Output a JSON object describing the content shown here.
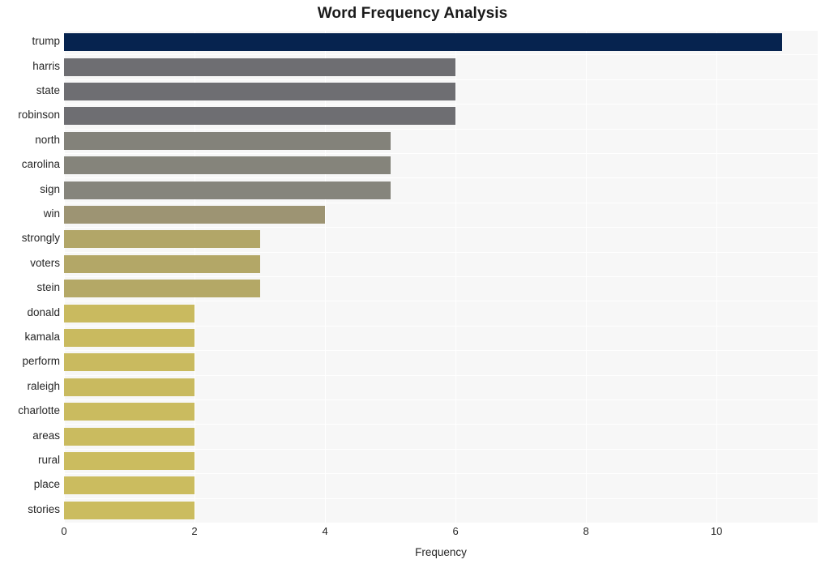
{
  "chart_data": {
    "type": "bar",
    "orientation": "horizontal",
    "title": "Word Frequency Analysis",
    "xlabel": "Frequency",
    "ylabel": "",
    "xlim": [
      0,
      11.55
    ],
    "xticks": [
      0,
      2,
      4,
      6,
      8,
      10
    ],
    "xtick_labels": [
      "0",
      "2",
      "4",
      "6",
      "8",
      "10"
    ],
    "grid": true,
    "grid_color": "#ffffff",
    "legend": "none",
    "plot_background": "#f7f7f7",
    "figure_background": "#ffffff",
    "categories": [
      "trump",
      "harris",
      "state",
      "robinson",
      "north",
      "carolina",
      "sign",
      "win",
      "strongly",
      "voters",
      "stein",
      "donald",
      "kamala",
      "perform",
      "raleigh",
      "charlotte",
      "areas",
      "rural",
      "place",
      "stories"
    ],
    "values": [
      11,
      6,
      6,
      6,
      5,
      5,
      5,
      4,
      3,
      3,
      3,
      2,
      2,
      2,
      2,
      2,
      2,
      2,
      2,
      2
    ],
    "bar_colors": [
      "#06234f",
      "#6e6e72",
      "#6e6e72",
      "#6e6e72",
      "#83827a",
      "#85847b",
      "#86857c",
      "#9d9473",
      "#b2a668",
      "#b3a767",
      "#b4a866",
      "#c9ba5f",
      "#c9ba5f",
      "#c9ba5f",
      "#c9ba5f",
      "#cabb5f",
      "#cabb5f",
      "#cbbc5f",
      "#cbbc5f",
      "#cbbc5f"
    ]
  }
}
